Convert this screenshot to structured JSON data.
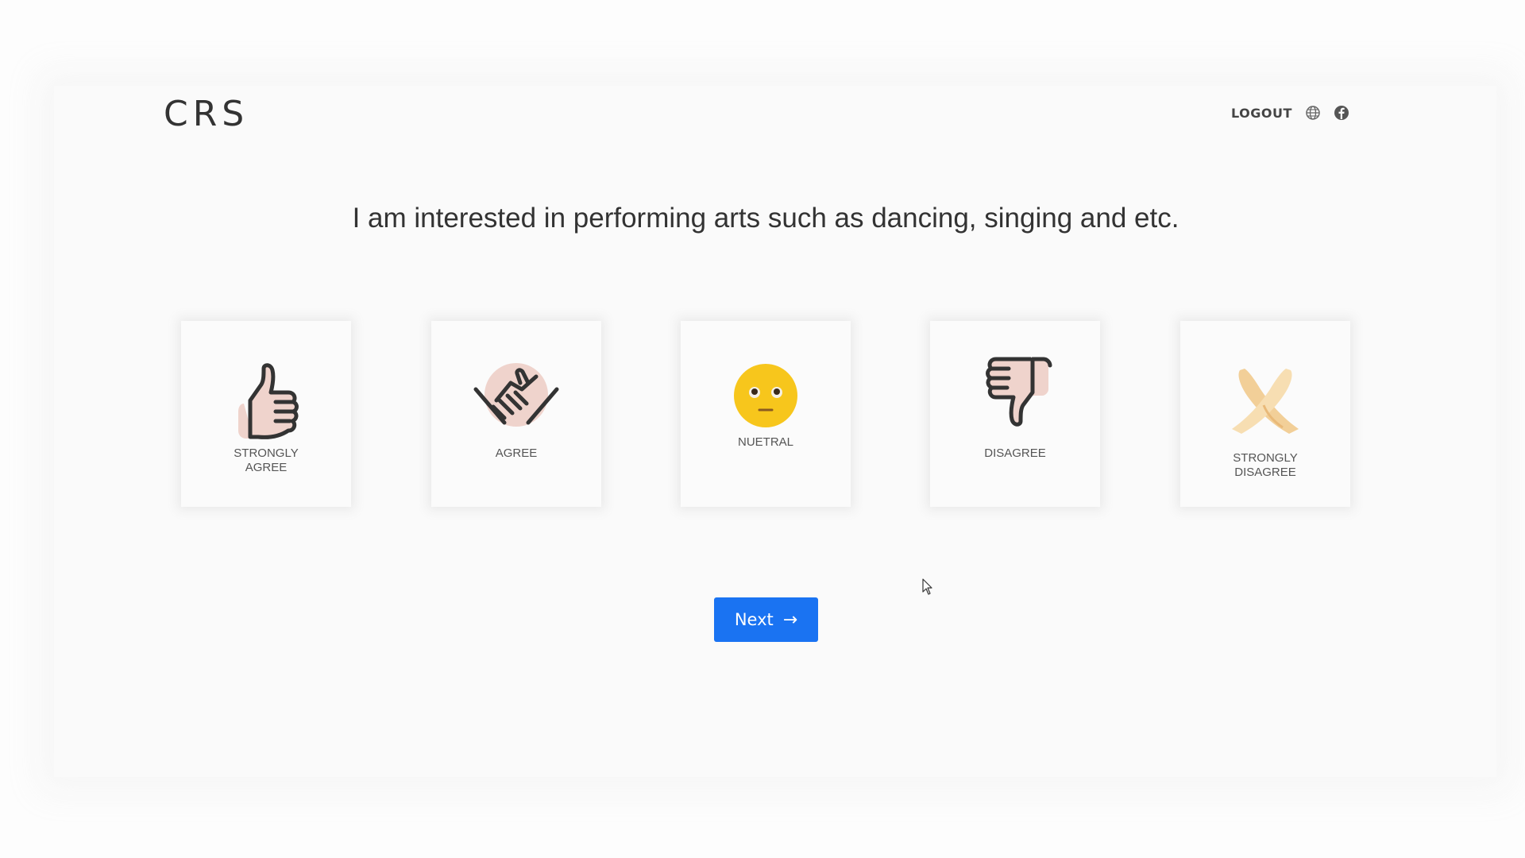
{
  "header": {
    "brand": "CRS",
    "logout_label": "LOGOUT",
    "icons": [
      "globe-icon",
      "facebook-icon"
    ]
  },
  "question": {
    "text": "I am interested in performing arts such as dancing, singing and etc."
  },
  "options": [
    {
      "line1": "STRONGLY",
      "line2": "AGREE",
      "icon": "thumbs-up-icon"
    },
    {
      "line1": "AGREE",
      "line2": "",
      "icon": "handshake-icon"
    },
    {
      "line1": "NUETRAL",
      "line2": "",
      "icon": "neutral-face-icon"
    },
    {
      "line1": "DISAGREE",
      "line2": "",
      "icon": "thumbs-down-icon"
    },
    {
      "line1": "STRONGLY",
      "line2": "DISAGREE",
      "icon": "crossed-hands-icon"
    }
  ],
  "actions": {
    "next_label": "Next",
    "next_icon": "arrow-right-icon"
  },
  "colors": {
    "accent": "#1a73f2",
    "skin": "#efd3cc",
    "emoji": "#f7c61c"
  }
}
